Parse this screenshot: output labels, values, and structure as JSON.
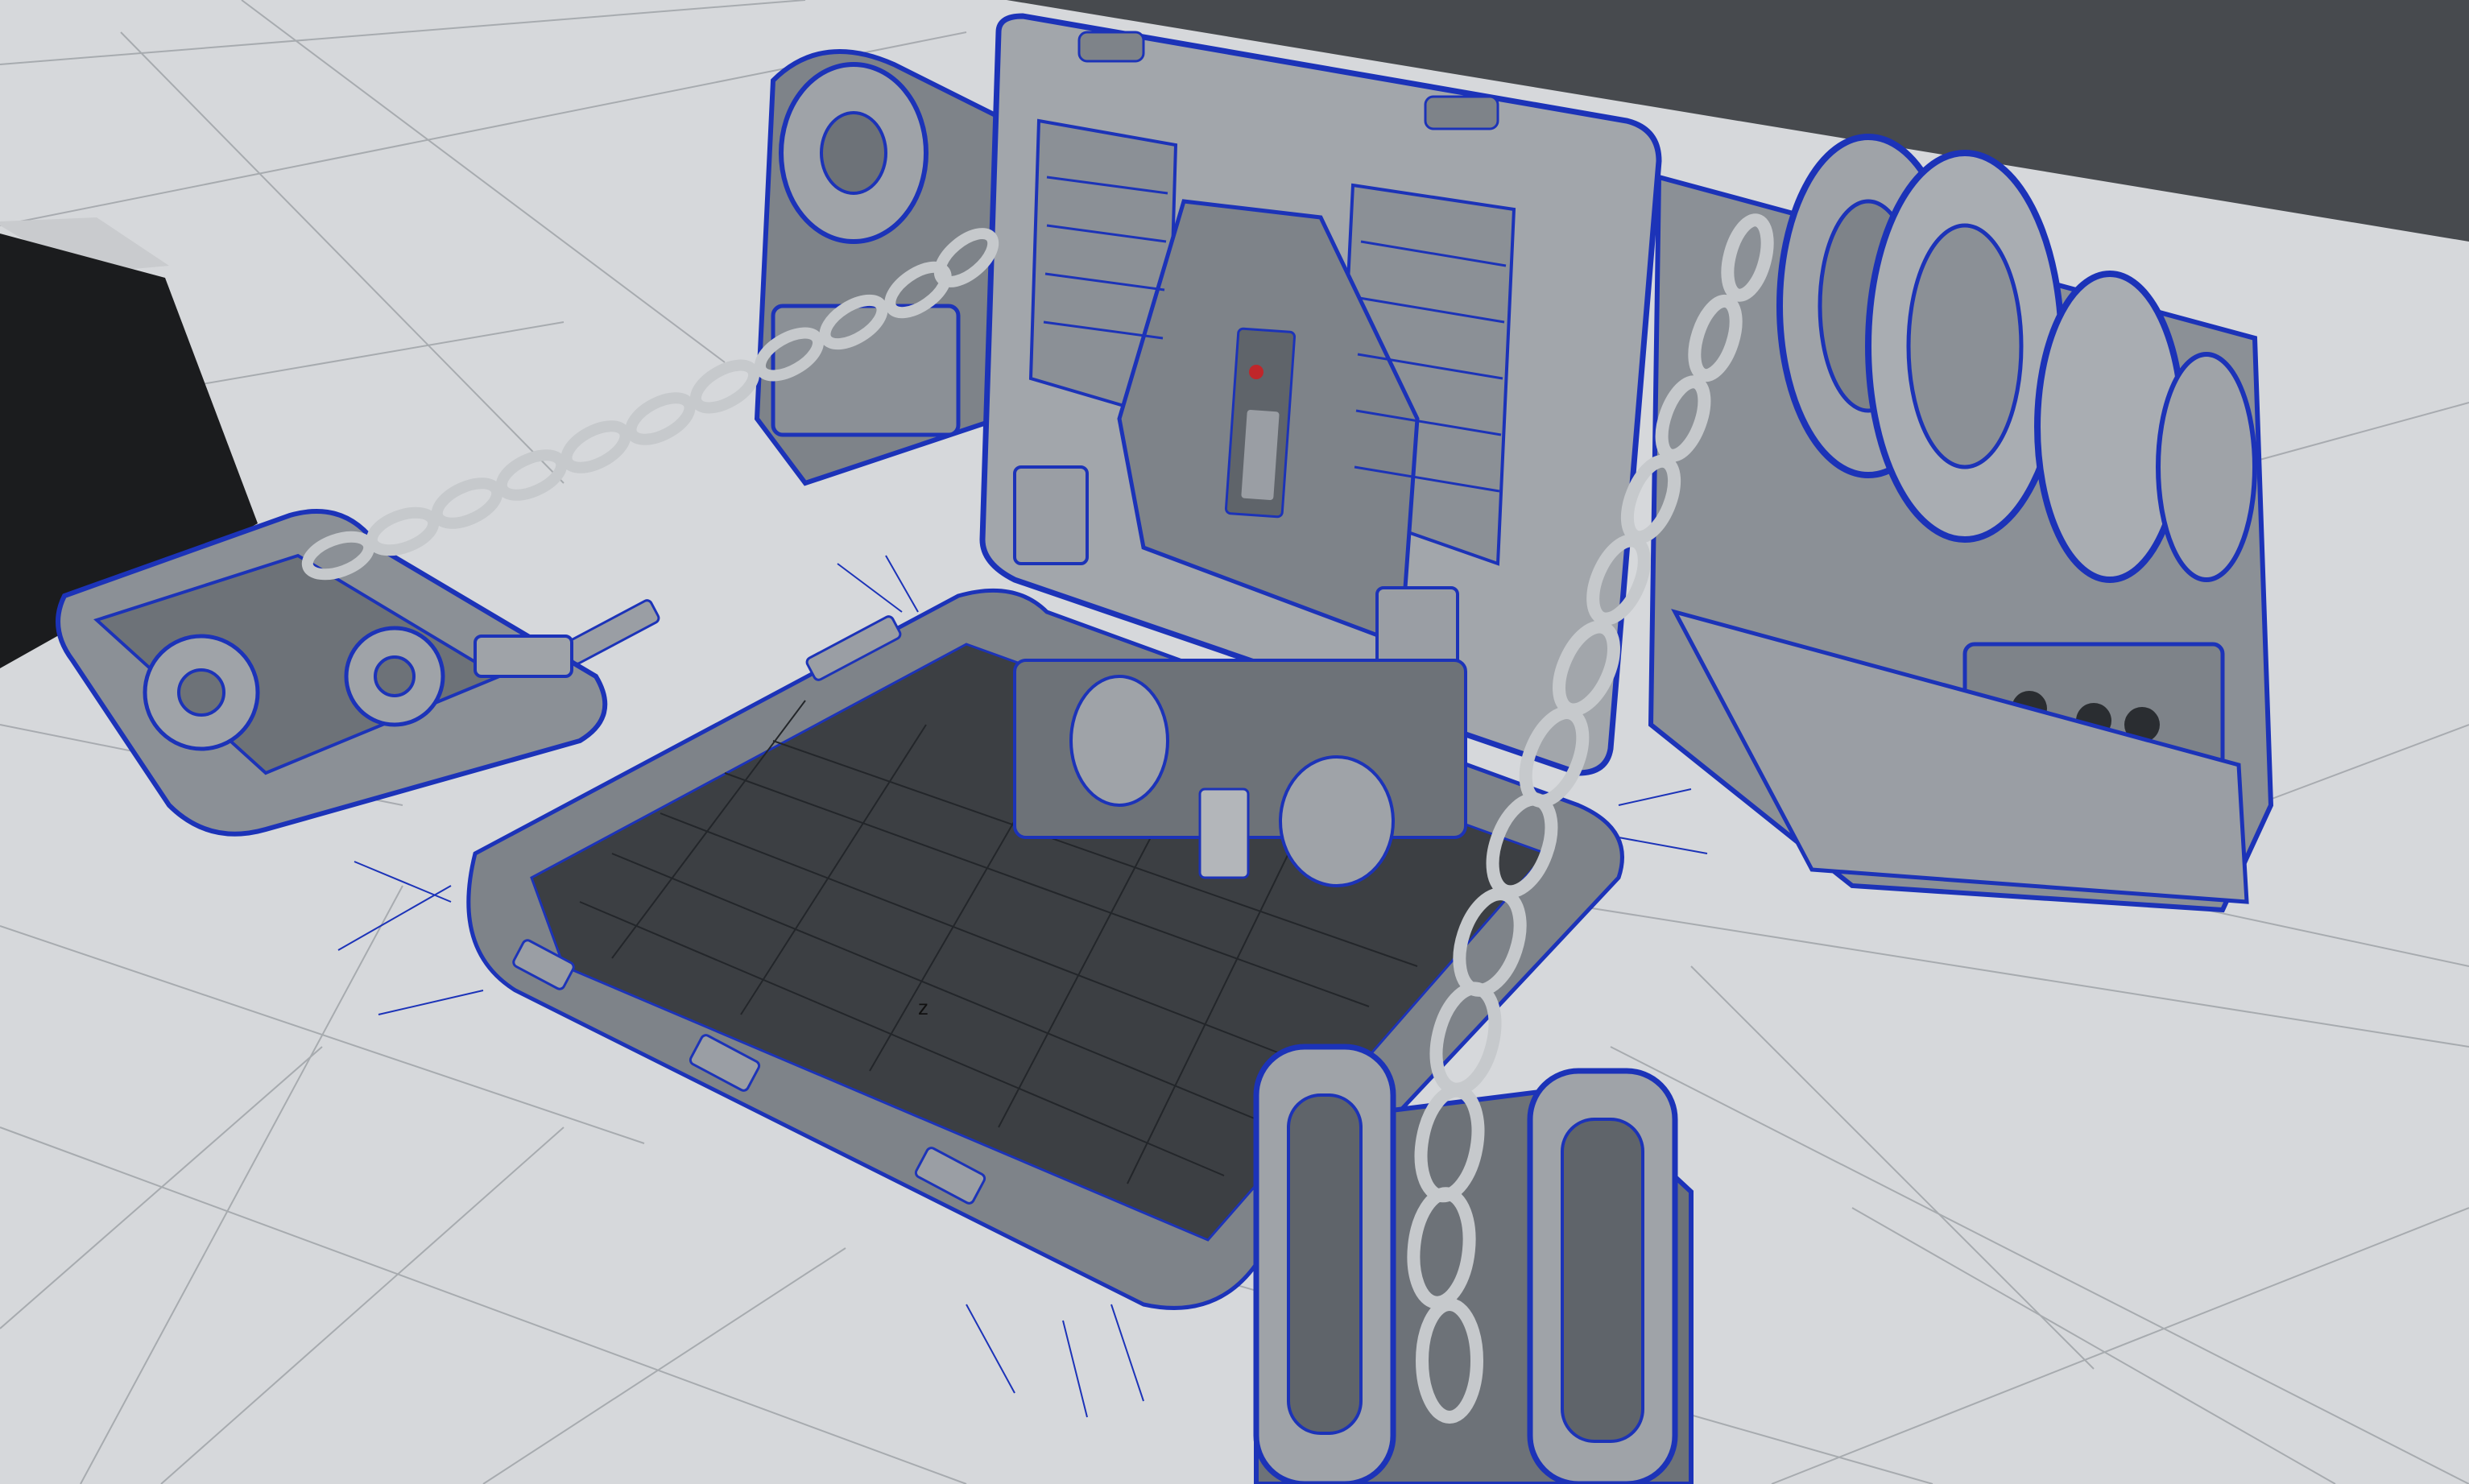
{
  "viewport": {
    "axis_label": "z",
    "colors": {
      "floor": "#dfe1e4",
      "backdrop": "#474a4e",
      "hull_grid": "#2a2d31",
      "pit_floor": "#3c3f43",
      "metal_light": "#a9adb2",
      "metal_mid": "#8b9096",
      "metal_dark": "#5f646a",
      "wireframe": "#1c33b8",
      "chain": "#c6c9cc",
      "indicator": "#c0262a"
    },
    "icons": {
      "scene": "3d-model-wireframe-icon"
    }
  }
}
